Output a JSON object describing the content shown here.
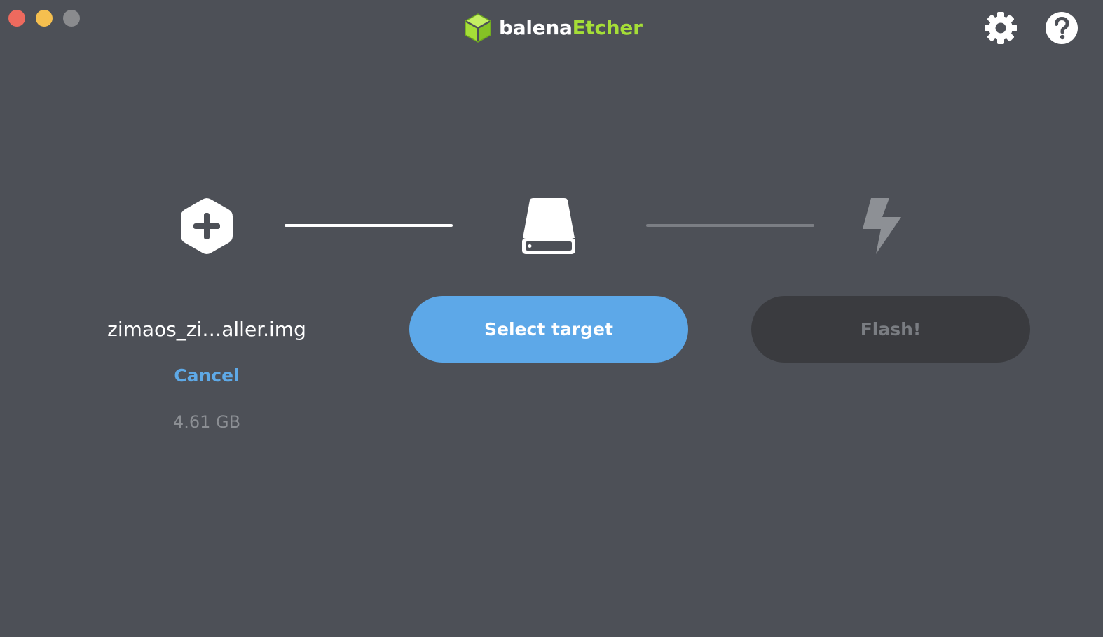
{
  "window": {
    "controls": [
      "close",
      "minimize",
      "maximize"
    ]
  },
  "header": {
    "logo": {
      "part1": "balena",
      "part2": "Etcher",
      "icon": "cube-icon",
      "accent": "#a5de37"
    },
    "icons": [
      "gear-icon",
      "help-icon"
    ]
  },
  "steps": {
    "source": {
      "icon": "plus-hexagon-icon",
      "filename": "zimaos_zi…aller.img",
      "cancel_label": "Cancel",
      "size": "4.61 GB"
    },
    "target": {
      "icon": "drive-icon",
      "button_label": "Select target",
      "button_color": "#5da8e8"
    },
    "flash": {
      "icon": "flash-icon",
      "button_label": "Flash!",
      "disabled": true
    }
  }
}
